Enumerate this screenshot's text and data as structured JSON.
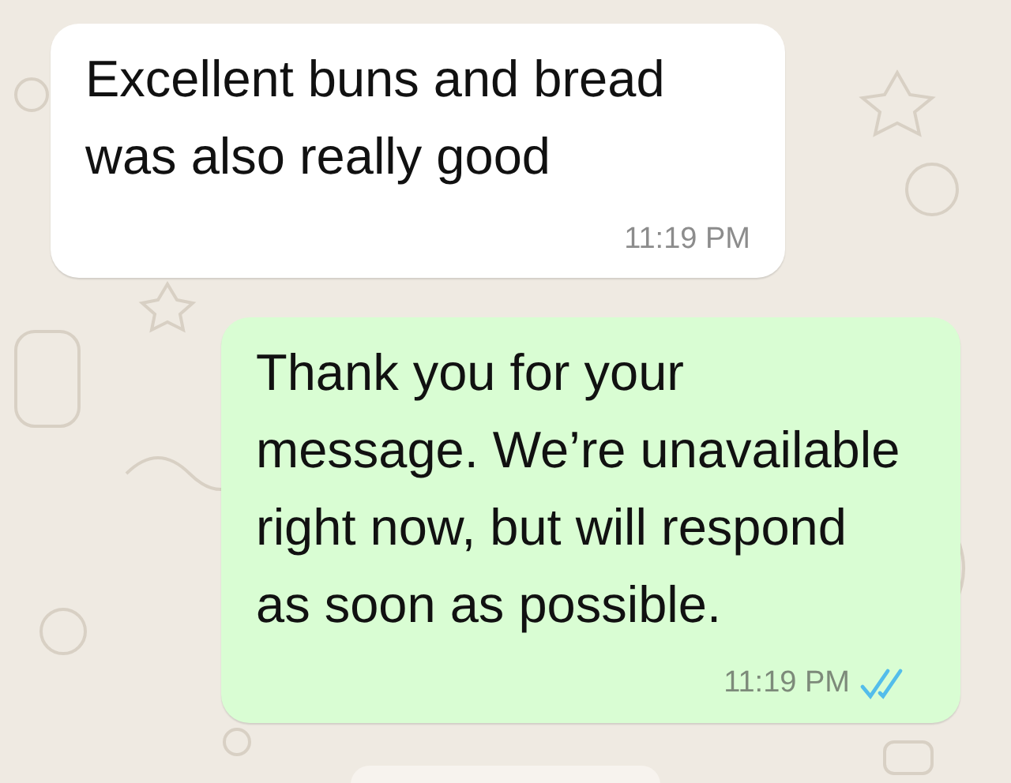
{
  "messages": [
    {
      "kind": "incoming",
      "text": "Excellent buns and bread was also really good",
      "time": "11:19 PM"
    },
    {
      "kind": "outgoing",
      "text": "Thank you for your message. We’re unavailable right now, but will respond as soon as possible.",
      "time": "11:19 PM",
      "read": true
    }
  ]
}
